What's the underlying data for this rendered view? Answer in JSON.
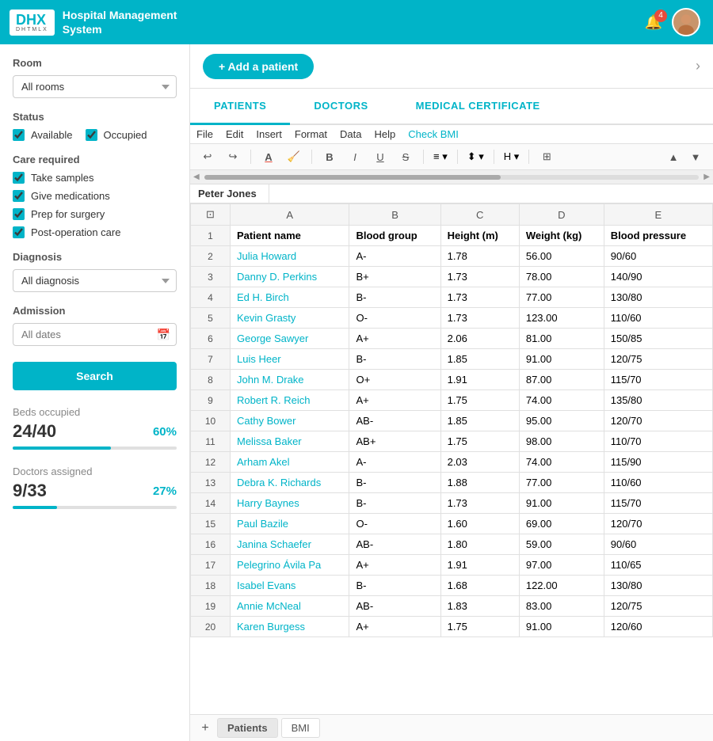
{
  "header": {
    "logo_text": "DHX",
    "logo_sub": "DHTMLX",
    "title_line1": "Hospital Management",
    "title_line2": "System",
    "notification_count": "4"
  },
  "sidebar": {
    "room_label": "Room",
    "room_placeholder": "All rooms",
    "status_label": "Status",
    "status_available": "Available",
    "status_occupied": "Occupied",
    "care_label": "Care required",
    "care_items": [
      "Take samples",
      "Give medications",
      "Prep for surgery",
      "Post-operation care"
    ],
    "diagnosis_label": "Diagnosis",
    "diagnosis_placeholder": "All diagnosis",
    "admission_label": "Admission",
    "admission_placeholder": "All dates",
    "search_btn": "Search",
    "beds_label": "Beds occupied",
    "beds_value": "24/40",
    "beds_pct": "60%",
    "beds_fill": 60,
    "doctors_label": "Doctors assigned",
    "doctors_value": "9/33",
    "doctors_pct": "27%",
    "doctors_fill": 27
  },
  "top_bar": {
    "add_btn": "+ Add a patient"
  },
  "tabs": [
    {
      "label": "PATIENTS",
      "active": true
    },
    {
      "label": "DOCTORS",
      "active": false
    },
    {
      "label": "MEDICAL CERTIFICATE",
      "active": false
    }
  ],
  "spreadsheet": {
    "menu_items": [
      "File",
      "Edit",
      "Insert",
      "Format",
      "Data",
      "Help",
      "Check BMI"
    ],
    "cell_name": "Peter Jones",
    "columns": [
      "A",
      "B",
      "C",
      "D",
      "E"
    ],
    "col_headers": [
      "Patient name",
      "Blood group",
      "Height (m)",
      "Weight (kg)",
      "Blood pressure"
    ],
    "rows": [
      {
        "num": 2,
        "name": "Julia Howard",
        "blood": "A-",
        "height": "1.78",
        "weight": "56.00",
        "bp": "90/60"
      },
      {
        "num": 3,
        "name": "Danny D. Perkins",
        "blood": "B+",
        "height": "1.73",
        "weight": "78.00",
        "bp": "140/90"
      },
      {
        "num": 4,
        "name": "Ed H. Birch",
        "blood": "B-",
        "height": "1.73",
        "weight": "77.00",
        "bp": "130/80"
      },
      {
        "num": 5,
        "name": "Kevin Grasty",
        "blood": "O-",
        "height": "1.73",
        "weight": "123.00",
        "bp": "110/60"
      },
      {
        "num": 6,
        "name": "George Sawyer",
        "blood": "A+",
        "height": "2.06",
        "weight": "81.00",
        "bp": "150/85"
      },
      {
        "num": 7,
        "name": "Luis Heer",
        "blood": "B-",
        "height": "1.85",
        "weight": "91.00",
        "bp": "120/75"
      },
      {
        "num": 8,
        "name": "John M. Drake",
        "blood": "O+",
        "height": "1.91",
        "weight": "87.00",
        "bp": "115/70"
      },
      {
        "num": 9,
        "name": "Robert R. Reich",
        "blood": "A+",
        "height": "1.75",
        "weight": "74.00",
        "bp": "135/80"
      },
      {
        "num": 10,
        "name": "Cathy Bower",
        "blood": "AB-",
        "height": "1.85",
        "weight": "95.00",
        "bp": "120/70"
      },
      {
        "num": 11,
        "name": "Melissa Baker",
        "blood": "AB+",
        "height": "1.75",
        "weight": "98.00",
        "bp": "110/70"
      },
      {
        "num": 12,
        "name": "Arham Akel",
        "blood": "A-",
        "height": "2.03",
        "weight": "74.00",
        "bp": "115/90"
      },
      {
        "num": 13,
        "name": "Debra K. Richards",
        "blood": "B-",
        "height": "1.88",
        "weight": "77.00",
        "bp": "110/60"
      },
      {
        "num": 14,
        "name": "Harry Baynes",
        "blood": "B-",
        "height": "1.73",
        "weight": "91.00",
        "bp": "115/70"
      },
      {
        "num": 15,
        "name": "Paul Bazile",
        "blood": "O-",
        "height": "1.60",
        "weight": "69.00",
        "bp": "120/70"
      },
      {
        "num": 16,
        "name": "Janina Schaefer",
        "blood": "AB-",
        "height": "1.80",
        "weight": "59.00",
        "bp": "90/60"
      },
      {
        "num": 17,
        "name": "Pelegrino Ávila Pa",
        "blood": "A+",
        "height": "1.91",
        "weight": "97.00",
        "bp": "110/65"
      },
      {
        "num": 18,
        "name": "Isabel Evans",
        "blood": "B-",
        "height": "1.68",
        "weight": "122.00",
        "bp": "130/80"
      },
      {
        "num": 19,
        "name": "Annie McNeal",
        "blood": "AB-",
        "height": "1.83",
        "weight": "83.00",
        "bp": "120/75"
      },
      {
        "num": 20,
        "name": "Karen Burgess",
        "blood": "A+",
        "height": "1.75",
        "weight": "91.00",
        "bp": "120/60"
      }
    ],
    "sheet_tabs": [
      "Patients",
      "BMI"
    ]
  }
}
